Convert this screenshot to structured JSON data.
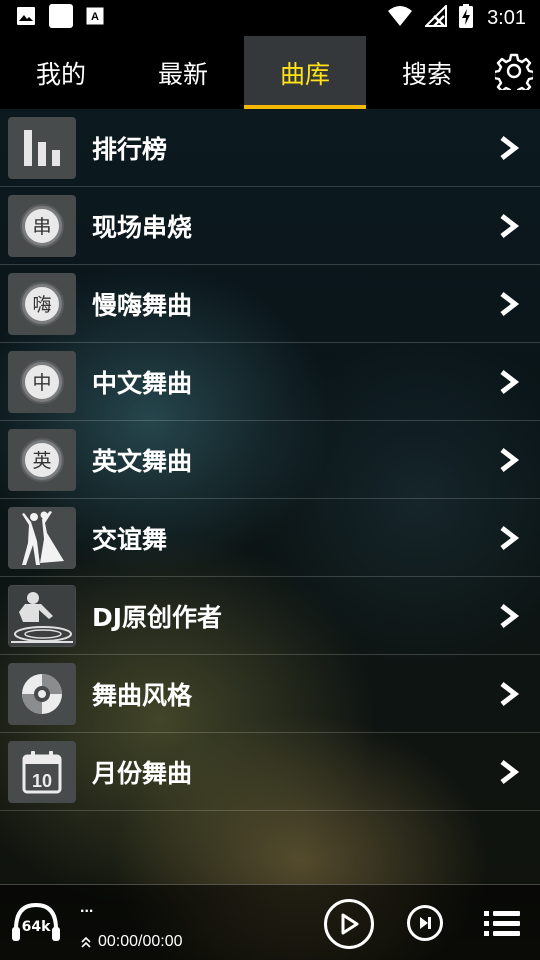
{
  "status_bar": {
    "time": "3:01",
    "icons": [
      "image-icon",
      "square-icon",
      "font-icon",
      "wifi-icon",
      "no-signal-icon",
      "battery-charging-icon"
    ]
  },
  "tabs": [
    {
      "label": "我的",
      "active": false
    },
    {
      "label": "最新",
      "active": false
    },
    {
      "label": "曲库",
      "active": true
    },
    {
      "label": "搜索",
      "active": false
    }
  ],
  "settings_icon": "gear-icon",
  "colors": {
    "active_tab_text": "#ffe21a",
    "active_tab_underline": "#f5b800",
    "active_tab_bg": "#35383b"
  },
  "categories": [
    {
      "label": "排行榜",
      "icon": "bar-chart-icon"
    },
    {
      "label": "现场串烧",
      "icon": "badge-icon",
      "badge": "串"
    },
    {
      "label": "慢嗨舞曲",
      "icon": "badge-icon",
      "badge": "嗨"
    },
    {
      "label": "中文舞曲",
      "icon": "badge-icon",
      "badge": "中"
    },
    {
      "label": "英文舞曲",
      "icon": "badge-icon",
      "badge": "英"
    },
    {
      "label": "交谊舞",
      "icon": "ballroom-dance-icon"
    },
    {
      "label": "DJ原创作者",
      "icon": "dj-turntable-icon"
    },
    {
      "label": "舞曲风格",
      "icon": "vinyl-disc-icon"
    },
    {
      "label": "月份舞曲",
      "icon": "calendar-icon",
      "calendar_day": "10"
    }
  ],
  "player": {
    "bitrate": "64k",
    "title": "...",
    "time": "00:00/00:00"
  }
}
